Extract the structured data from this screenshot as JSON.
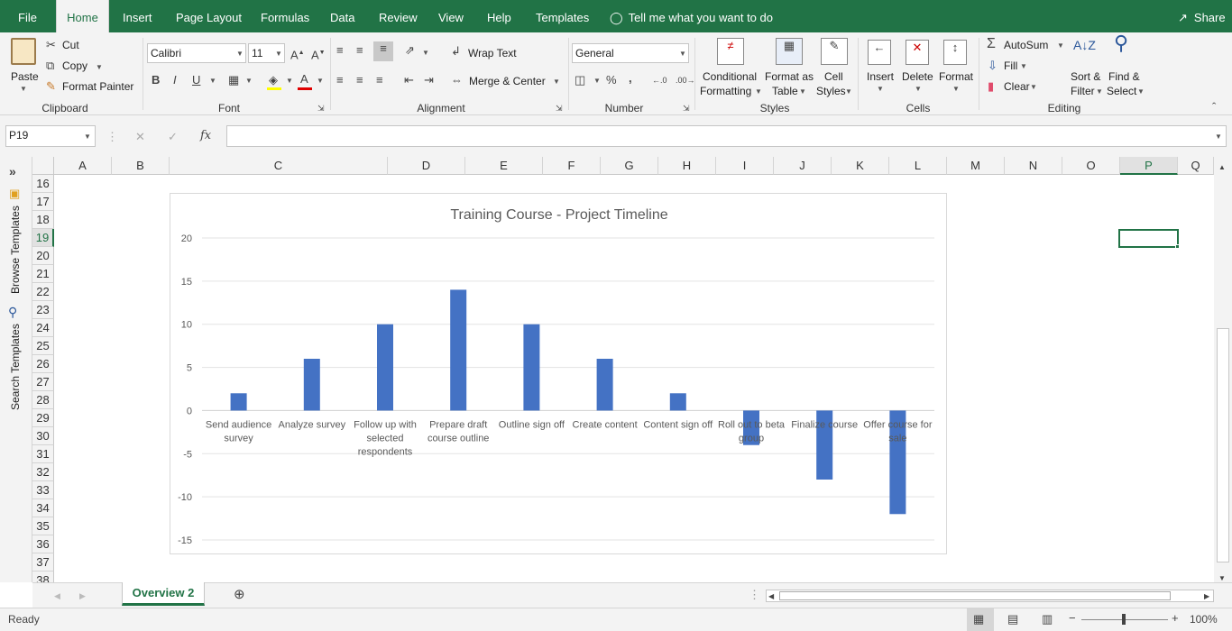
{
  "menu": {
    "tabs": [
      "File",
      "Home",
      "Insert",
      "Page Layout",
      "Formulas",
      "Data",
      "Review",
      "View",
      "Help",
      "Templates"
    ],
    "active": "Home",
    "tell_me": "Tell me what you want to do",
    "share": "Share"
  },
  "ribbon": {
    "clipboard": {
      "paste": "Paste",
      "cut": "Cut",
      "copy": "Copy",
      "format_painter": "Format Painter",
      "group": "Clipboard"
    },
    "font": {
      "name": "Calibri",
      "size": "11",
      "bold": "B",
      "italic": "I",
      "underline": "U",
      "group": "Font"
    },
    "alignment": {
      "wrap": "Wrap Text",
      "merge": "Merge & Center",
      "group": "Alignment"
    },
    "number": {
      "format": "General",
      "percent": "%",
      "comma": ",",
      "group": "Number"
    },
    "styles": {
      "conditional_1": "Conditional",
      "conditional_2": "Formatting",
      "format_table_1": "Format as",
      "format_table_2": "Table",
      "cell_styles_1": "Cell",
      "cell_styles_2": "Styles",
      "group": "Styles"
    },
    "cells": {
      "insert": "Insert",
      "delete": "Delete",
      "format": "Format",
      "group": "Cells"
    },
    "editing": {
      "autosum": "AutoSum",
      "fill": "Fill",
      "clear": "Clear",
      "sort_1": "Sort &",
      "sort_2": "Filter",
      "find_1": "Find &",
      "find_2": "Select",
      "group": "Editing"
    }
  },
  "formula_bar": {
    "name_box": "P19",
    "fx": "fx",
    "formula": ""
  },
  "columns": [
    "A",
    "B",
    "C",
    "D",
    "E",
    "F",
    "G",
    "H",
    "I",
    "J",
    "K",
    "L",
    "M",
    "N",
    "O",
    "P",
    "Q"
  ],
  "rows": [
    "16",
    "17",
    "18",
    "19",
    "20",
    "21",
    "22",
    "23",
    "24",
    "25",
    "26",
    "27",
    "28",
    "29",
    "30",
    "31",
    "32",
    "33",
    "34",
    "35",
    "36",
    "37",
    "38"
  ],
  "selected_cell": "P19",
  "sidepane": {
    "browse": "Browse Templates",
    "search": "Search Templates"
  },
  "sheet_tabs": {
    "active": "Overview 2"
  },
  "status": {
    "ready": "Ready",
    "zoom": "100%"
  },
  "chart_data": {
    "type": "bar",
    "title": "Training Course - Project Timeline",
    "categories": [
      "Send audience survey",
      "Analyze survey",
      "Follow up with selected respondents",
      "Prepare draft course outline",
      "Outline sign off",
      "Create content",
      "Content sign off",
      "Roll out to beta group",
      "Finalize course",
      "Offer course for sale"
    ],
    "values": [
      2,
      6,
      10,
      14,
      10,
      6,
      2,
      -4,
      -8,
      -12
    ],
    "ylim": [
      -15,
      20
    ],
    "yticks": [
      20,
      15,
      10,
      5,
      0,
      -5,
      -10,
      -15
    ],
    "grid": true,
    "color": "#4472c4"
  }
}
